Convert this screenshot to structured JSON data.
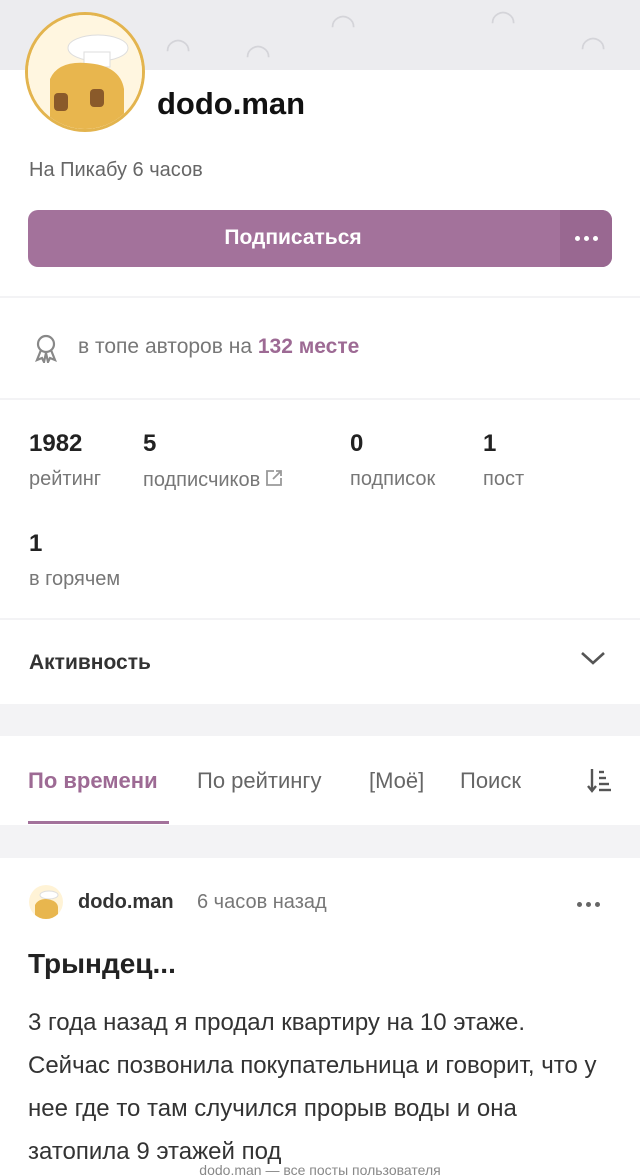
{
  "profile": {
    "username": "dodo.man",
    "since": "На Пикабу 6 часов",
    "subscribe_label": "Подписаться",
    "more_icon": "more-dots-icon"
  },
  "rank": {
    "prefix": "в топе авторов на",
    "place": "132 месте",
    "icon": "award-ribbon-icon"
  },
  "stats": {
    "rating": {
      "value": "1982",
      "label": "рейтинг"
    },
    "subscribers": {
      "value": "5",
      "label": "подписчиков"
    },
    "subscriptions": {
      "value": "0",
      "label": "подписок"
    },
    "posts": {
      "value": "1",
      "label": "пост"
    },
    "hot": {
      "value": "1",
      "label": "в горячем"
    }
  },
  "activity": {
    "label": "Активность"
  },
  "tabs": [
    {
      "label": "По времени",
      "active": true
    },
    {
      "label": "По рейтингу"
    },
    {
      "label": "[Моё]"
    },
    {
      "label": "Поиск"
    }
  ],
  "post": {
    "author": "dodo.man",
    "time": "6 часов назад",
    "title": "Трындец...",
    "body": "3 года назад я продал квартиру на 10 этаже. Сейчас позвонила покупательница и говорит, что у нее где то там случился прорыв воды и она затопила 9 этажей под"
  },
  "footer": {
    "text": "dodo.man — все посты пользователя"
  },
  "colors": {
    "accent": "#a3729b",
    "accent_text": "#9d6a94",
    "avatar_border": "#e3b44e"
  }
}
